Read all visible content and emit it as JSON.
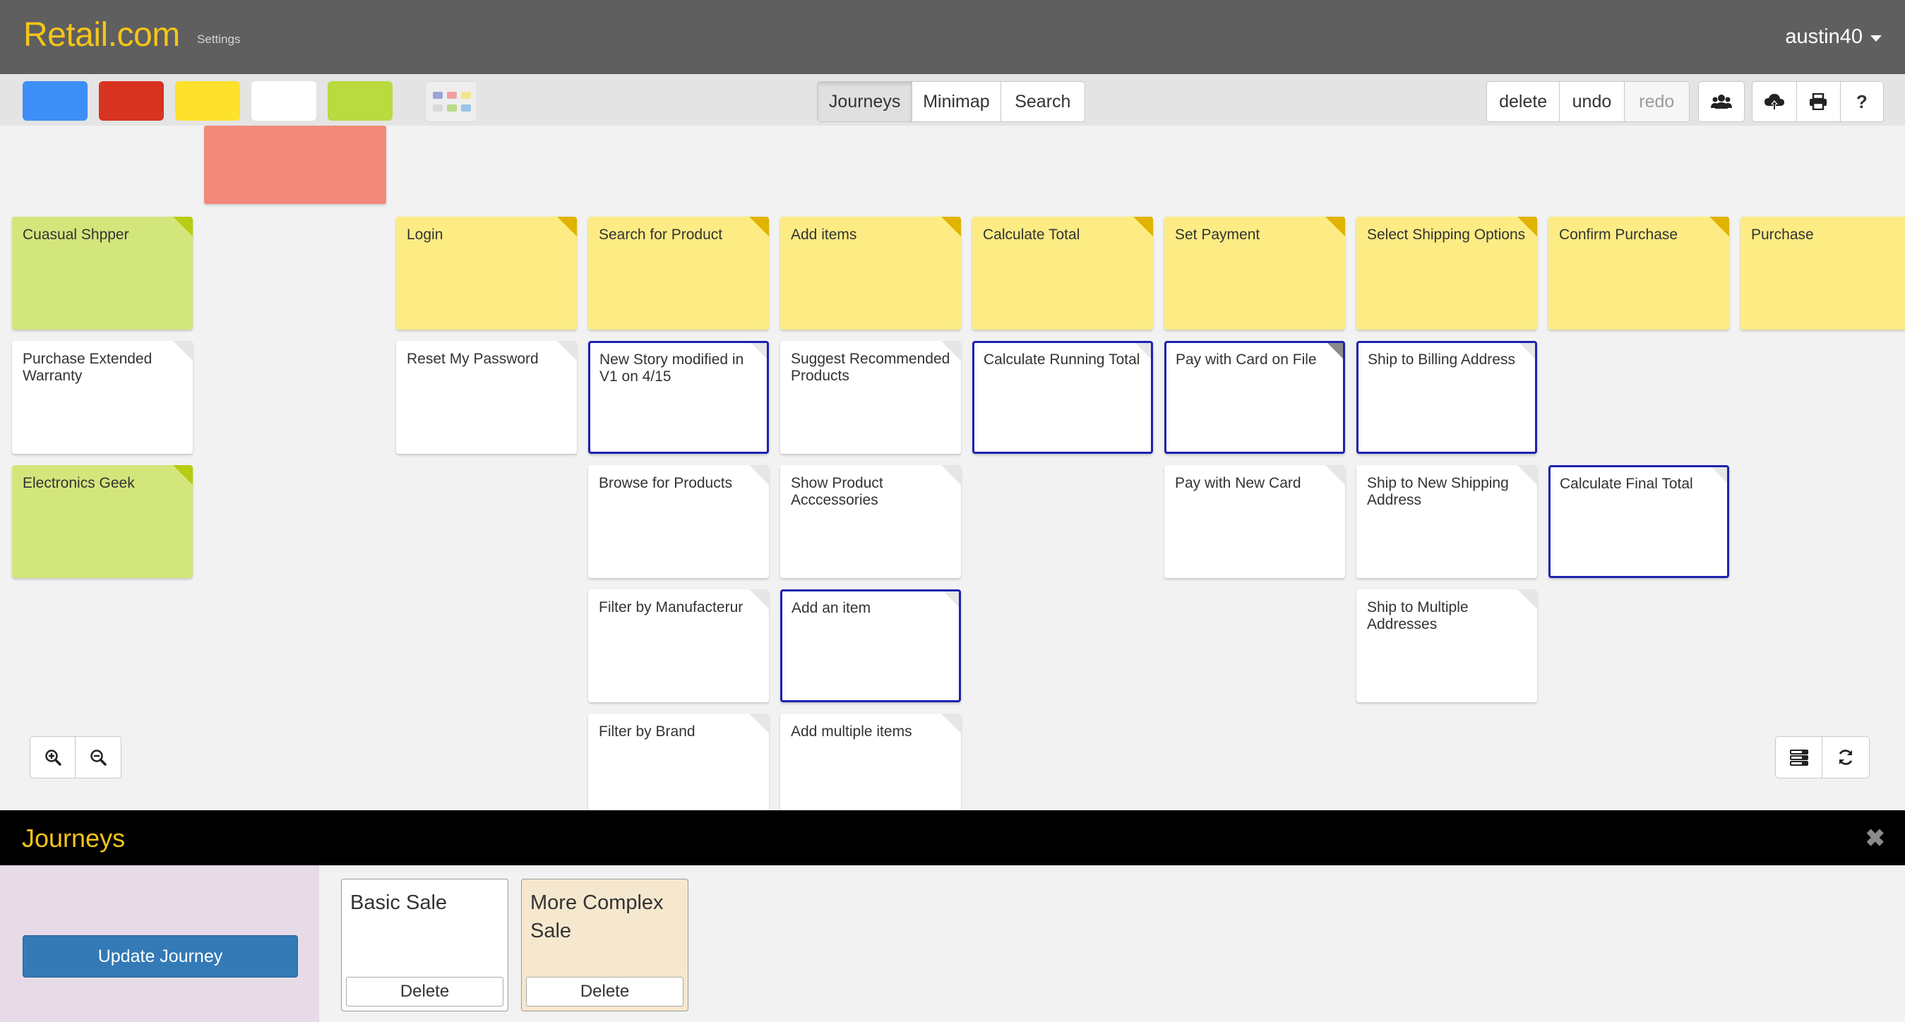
{
  "header": {
    "brand": "Retail.com",
    "settings_link": "Settings",
    "username": "austin40"
  },
  "toolbar": {
    "swatches": [
      {
        "name": "blue",
        "color": "#3e8ef7"
      },
      {
        "name": "red",
        "color": "#d83321"
      },
      {
        "name": "yellow",
        "color": "#fde12d"
      },
      {
        "name": "white",
        "color": "#ffffff"
      },
      {
        "name": "green",
        "color": "#bada40"
      }
    ],
    "view_tabs": [
      {
        "label": "Journeys",
        "active": true
      },
      {
        "label": "Minimap",
        "active": false
      },
      {
        "label": "Search",
        "active": false
      }
    ],
    "edit_buttons": [
      {
        "label": "delete",
        "enabled": true
      },
      {
        "label": "undo",
        "enabled": true
      },
      {
        "label": "redo",
        "enabled": false
      }
    ],
    "icon_buttons": [
      "users-icon",
      "cloud-upload-icon",
      "print-icon",
      "help-icon"
    ],
    "help_label": "?"
  },
  "board": {
    "row1": [
      {
        "text": "Cuasual Shpper",
        "color": "green"
      },
      {
        "text": "Login",
        "color": "yellow"
      },
      {
        "text": "Search for Product",
        "color": "yellow"
      },
      {
        "text": "Add items",
        "color": "yellow"
      },
      {
        "text": "Calculate Total",
        "color": "yellow"
      },
      {
        "text": "Set Payment",
        "color": "yellow"
      },
      {
        "text": "Select Shipping Options",
        "color": "yellow"
      },
      {
        "text": "Confirm Purchase",
        "color": "yellow"
      },
      {
        "text": "Purchase",
        "color": "yellow"
      }
    ],
    "row2": [
      {
        "text": "Purchase Extended Warranty",
        "selected": false
      },
      {
        "text": "Reset My Password",
        "selected": false
      },
      {
        "text": "New Story modified in V1 on 4/15",
        "selected": true
      },
      {
        "text": "Suggest Recommended Products",
        "selected": false
      },
      {
        "text": "Calculate Running Total",
        "selected": true
      },
      {
        "text": "Pay with Card on File",
        "selected": true
      },
      {
        "text": "Ship to Billing Address",
        "selected": true
      }
    ],
    "row3": [
      {
        "text": "Electronics Geek",
        "color": "green"
      },
      {
        "text": "Browse for Products",
        "selected": false
      },
      {
        "text": "Show Product Acccessories",
        "selected": false
      },
      {
        "text": "Pay with New Card",
        "selected": false
      },
      {
        "text": "Ship to New Shipping Address",
        "selected": false
      },
      {
        "text": "Calculate Final Total",
        "selected": true
      }
    ],
    "row4": [
      {
        "text": "Filter by Manufacterur",
        "selected": false
      },
      {
        "text": "Add an item",
        "selected": true
      },
      {
        "text": "Ship to Multiple Addresses",
        "selected": false
      }
    ],
    "row5": [
      {
        "text": "Filter by Brand",
        "selected": false
      },
      {
        "text": "Add multiple items",
        "selected": false
      }
    ]
  },
  "journeys": {
    "title": "Journeys",
    "update_button": "Update Journey",
    "items": [
      {
        "name": "Basic Sale",
        "delete_label": "Delete",
        "active": false
      },
      {
        "name": "More Complex Sale",
        "delete_label": "Delete",
        "active": true
      }
    ]
  }
}
